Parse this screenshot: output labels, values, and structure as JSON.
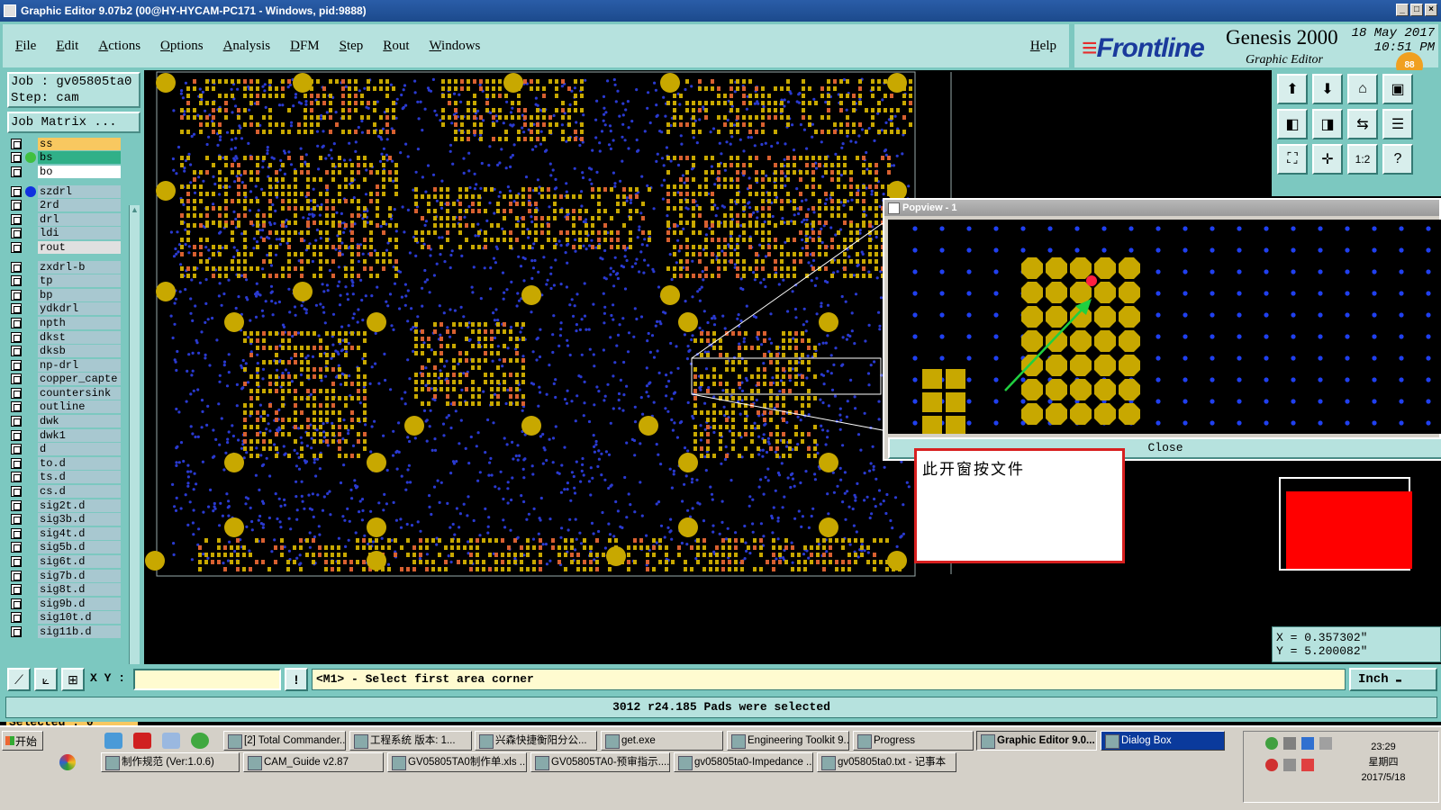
{
  "window": {
    "title": "Graphic Editor 9.07b2 (00@HY-HYCAM-PC171 - Windows, pid:9888)",
    "controls": [
      "_",
      "□",
      "×"
    ]
  },
  "menu": {
    "items": [
      "File",
      "Edit",
      "Actions",
      "Options",
      "Analysis",
      "DFM",
      "Step",
      "Rout",
      "Windows"
    ],
    "help": "Help"
  },
  "brand": {
    "logo": "Frontline",
    "product": "Genesis 2000",
    "subtitle": "Graphic Editor",
    "date": "18 May 2017",
    "time": "10:51 PM"
  },
  "job": {
    "job_line": "Job : gv05805ta0",
    "step_line": "Step: cam",
    "matrix_button": "Job Matrix ..."
  },
  "layers": [
    {
      "name": "ss",
      "color": "#f8c860",
      "dot": ""
    },
    {
      "name": "bs",
      "color": "#30b088",
      "dot": "#40c040"
    },
    {
      "name": "bo",
      "color": "#ffffff",
      "dot": ""
    },
    {
      "gap": true
    },
    {
      "name": "szdrl",
      "color": "#a8c8d0",
      "dot": "#1030e0"
    },
    {
      "name": "2rd",
      "color": "#a8c8d0",
      "dot": ""
    },
    {
      "name": "drl",
      "color": "#a8c8d0",
      "dot": ""
    },
    {
      "name": "ldi",
      "color": "#a8c8d0",
      "dot": ""
    },
    {
      "name": "rout",
      "color": "#e0e0e0",
      "dot": ""
    },
    {
      "gap": true
    },
    {
      "name": "zxdrl-b",
      "color": "#a8c8d0",
      "dot": ""
    },
    {
      "name": "tp",
      "color": "#a8c8d0",
      "dot": ""
    },
    {
      "name": "bp",
      "color": "#a8c8d0",
      "dot": ""
    },
    {
      "name": "ydkdrl",
      "color": "#a8c8d0",
      "dot": ""
    },
    {
      "name": "npth",
      "color": "#a8c8d0",
      "dot": ""
    },
    {
      "name": "dkst",
      "color": "#a8c8d0",
      "dot": ""
    },
    {
      "name": "dksb",
      "color": "#a8c8d0",
      "dot": ""
    },
    {
      "name": "np-drl",
      "color": "#a8c8d0",
      "dot": ""
    },
    {
      "name": "copper_capte",
      "color": "#a8c8d0",
      "dot": ""
    },
    {
      "name": "countersink",
      "color": "#a8c8d0",
      "dot": ""
    },
    {
      "name": "outline",
      "color": "#a8c8d0",
      "dot": ""
    },
    {
      "name": "dwk",
      "color": "#a8c8d0",
      "dot": ""
    },
    {
      "name": "dwk1",
      "color": "#a8c8d0",
      "dot": ""
    },
    {
      "name": "d",
      "color": "#a8c8d0",
      "dot": ""
    },
    {
      "name": "to.d",
      "color": "#a8c8d0",
      "dot": ""
    },
    {
      "name": "ts.d",
      "color": "#a8c8d0",
      "dot": ""
    },
    {
      "name": "cs.d",
      "color": "#a8c8d0",
      "dot": ""
    },
    {
      "name": "sig2t.d",
      "color": "#a8c8d0",
      "dot": ""
    },
    {
      "name": "sig3b.d",
      "color": "#a8c8d0",
      "dot": ""
    },
    {
      "name": "sig4t.d",
      "color": "#a8c8d0",
      "dot": ""
    },
    {
      "name": "sig5b.d",
      "color": "#a8c8d0",
      "dot": ""
    },
    {
      "name": "sig6t.d",
      "color": "#a8c8d0",
      "dot": ""
    },
    {
      "name": "sig7b.d",
      "color": "#a8c8d0",
      "dot": ""
    },
    {
      "name": "sig8t.d",
      "color": "#a8c8d0",
      "dot": ""
    },
    {
      "name": "sig9b.d",
      "color": "#a8c8d0",
      "dot": ""
    },
    {
      "name": "sig10t.d",
      "color": "#a8c8d0",
      "dot": ""
    },
    {
      "name": "sig11b.d",
      "color": "#a8c8d0",
      "dot": ""
    }
  ],
  "selected": "Selected : 0",
  "colors": {
    "pad": "#c8a800",
    "via": "#1a2a9a",
    "highlight": "#d86030",
    "panel": "#7cc8c0",
    "panel_light": "#b6e2de",
    "selected_marker": "#ff2040",
    "arrow": "#20d040"
  },
  "tools": [
    {
      "icon": "top-view-icon",
      "glyph": "⬆"
    },
    {
      "icon": "bottom-view-icon",
      "glyph": "⬇"
    },
    {
      "icon": "home-icon",
      "glyph": "⌂"
    },
    {
      "icon": "panel-icon",
      "glyph": "▣"
    },
    {
      "icon": "pan-left-icon",
      "glyph": "◧"
    },
    {
      "icon": "pan-right-icon",
      "glyph": "◨"
    },
    {
      "icon": "mirror-icon",
      "glyph": "⇆"
    },
    {
      "icon": "layers-icon",
      "glyph": "☰"
    },
    {
      "icon": "fit-icon",
      "glyph": "⛶"
    },
    {
      "icon": "zoom-center-icon",
      "glyph": "✛"
    },
    {
      "icon": "scale-icon",
      "glyph": "1:2"
    },
    {
      "icon": "help-icon",
      "glyph": "?"
    }
  ],
  "popview": {
    "title": "Popview - 1",
    "close_label": "Close"
  },
  "note": "此开窗按文件",
  "coords": {
    "x": "X = 0.357302\"",
    "y": "Y = 5.200082\""
  },
  "command": {
    "xy_label": "X Y :",
    "xy_value": "",
    "exclaim": "!",
    "prompt": "<M1> - Select first area corner",
    "units": "Inch"
  },
  "status": "3012 r24.185 Pads were selected",
  "taskbar": {
    "start": "开始",
    "row1": [
      "[2] Total Commander...",
      "工程系统  版本: 1...",
      "兴森快捷衡阳分公...",
      "get.exe",
      "Engineering Toolkit 9...",
      "Progress",
      "Graphic Editor 9.0...",
      "Dialog Box"
    ],
    "row2": [
      "制作规范 (Ver:1.0.6)",
      "CAM_Guide v2.87",
      "GV05805TA0制作单.xls ...",
      "GV05805TA0-预审指示....",
      "gv05805ta0-Impedance ...",
      "gv05805ta0.txt - 记事本"
    ],
    "time": "23:29",
    "weekday": "星期四",
    "date": "2017/5/18",
    "badge": "88"
  }
}
